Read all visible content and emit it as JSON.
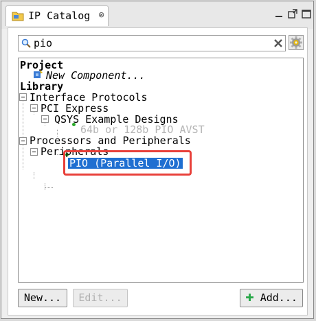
{
  "tab": {
    "title": "IP Catalog",
    "close_symbol": "⊗"
  },
  "search": {
    "value": "pio",
    "placeholder": ""
  },
  "tree": {
    "project_label": "Project",
    "new_component": "New Component...",
    "library_label": "Library",
    "interface_protocols": "Interface Protocols",
    "pci_express": "PCI Express",
    "qsys_example_designs": "QSYS Example Designs",
    "pio_avst": "64b or 128b PIO AVST",
    "processors_peripherals": "Processors and Peripherals",
    "peripherals": "Peripherals",
    "pio_parallel": "PIO (Parallel I/O)"
  },
  "buttons": {
    "new_label": "New...",
    "edit_label": "Edit...",
    "add_label": "Add..."
  },
  "colors": {
    "selection": "#1f6fd1",
    "highlight": "#e8403a",
    "dot": "#29a829",
    "add_plus": "#2aa84a"
  }
}
